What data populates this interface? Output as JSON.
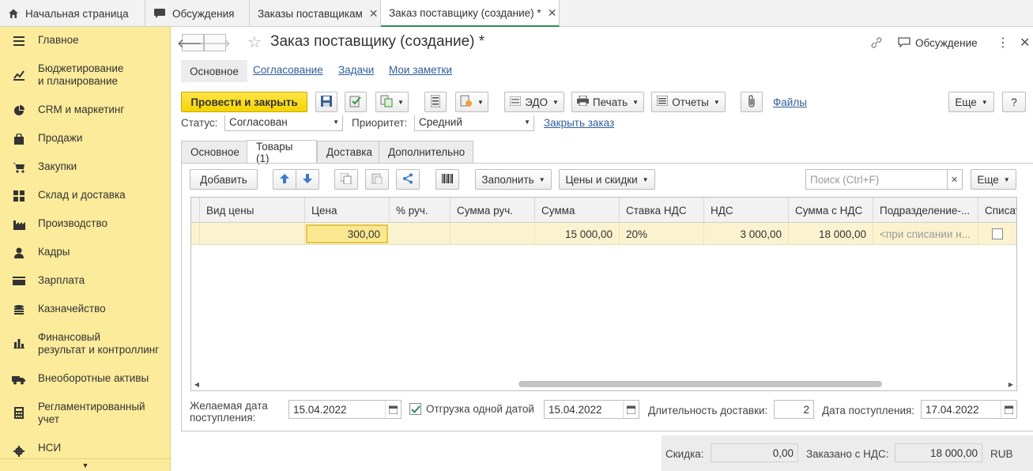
{
  "tabs": [
    {
      "label": "Начальная страница",
      "icon": "home-icon"
    },
    {
      "label": "Обсуждения",
      "icon": "chat-icon"
    },
    {
      "label": "Заказы поставщикам",
      "icon": "close-icon"
    },
    {
      "label": "Заказ поставщику (создание) *",
      "icon": "close-icon",
      "active": true
    }
  ],
  "sidebar": {
    "items": [
      {
        "label": "Главное",
        "icon": "menu-icon"
      },
      {
        "label": "Бюджетирование\nи планирование",
        "icon": "chart-line-icon"
      },
      {
        "label": "CRM и маркетинг",
        "icon": "pie-icon"
      },
      {
        "label": "Продажи",
        "icon": "bag-icon"
      },
      {
        "label": "Закупки",
        "icon": "cart-icon"
      },
      {
        "label": "Склад и доставка",
        "icon": "grid-icon"
      },
      {
        "label": "Производство",
        "icon": "factory-icon"
      },
      {
        "label": "Кадры",
        "icon": "person-icon"
      },
      {
        "label": "Зарплата",
        "icon": "wallet-icon"
      },
      {
        "label": "Казначейство",
        "icon": "coins-icon"
      },
      {
        "label": "Финансовый\nрезультат и контроллинг",
        "icon": "bar-chart-icon"
      },
      {
        "label": "Внеоборотные активы",
        "icon": "truck-icon"
      },
      {
        "label": "Регламентированный\nучет",
        "icon": "calculator-icon"
      },
      {
        "label": "НСИ",
        "icon": "gear-icon"
      }
    ]
  },
  "header": {
    "title": "Заказ поставщику (создание) *",
    "discussion": "Обсуждение"
  },
  "nav_links": [
    "Основное",
    "Согласование",
    "Задачи",
    "Мои заметки"
  ],
  "toolbar": {
    "post_close": "Провести и закрыть",
    "edo": "ЭДО",
    "print": "Печать",
    "reports": "Отчеты",
    "files": "Файлы",
    "more": "Еще",
    "help": "?"
  },
  "status_row": {
    "status_label": "Статус:",
    "status_value": "Согласован",
    "priority_label": "Приоритет:",
    "priority_value": "Средний",
    "close_order": "Закрыть заказ"
  },
  "subtabs": [
    "Основное",
    "Товары (1)",
    "Доставка",
    "Дополнительно"
  ],
  "grid_toolbar": {
    "add": "Добавить",
    "fill": "Заполнить",
    "prices": "Цены и скидки",
    "search_placeholder": "Поиск (Ctrl+F)",
    "more": "Еще"
  },
  "table": {
    "columns": [
      "Вид цены",
      "Цена",
      "% руч.",
      "Сумма руч.",
      "Сумма",
      "Ставка НДС",
      "НДС",
      "Сумма с НДС",
      "Подразделение-...",
      "Списат"
    ],
    "rows": [
      {
        "vid_ceny": "",
        "cena": "300,00",
        "pct": "",
        "summa_ruch": "",
        "summa": "15 000,00",
        "stavka": "20%",
        "nds": "3 000,00",
        "summa_nds": "18 000,00",
        "podrazd": "<при списании н...",
        "spisat": false
      }
    ]
  },
  "delivery": {
    "desired_label": "Желаемая дата\nпоступления:",
    "desired_date": "15.04.2022",
    "single_date_label": "Отгрузка одной датой",
    "single_date_checked": true,
    "single_date": "15.04.2022",
    "duration_label": "Длительность доставки:",
    "duration": "2",
    "arrival_label": "Дата поступления:",
    "arrival_date": "17.04.2022"
  },
  "totals": {
    "discount_label": "Скидка:",
    "discount": "0,00",
    "ordered_label": "Заказано с НДС:",
    "ordered": "18 000,00",
    "currency": "RUB"
  }
}
